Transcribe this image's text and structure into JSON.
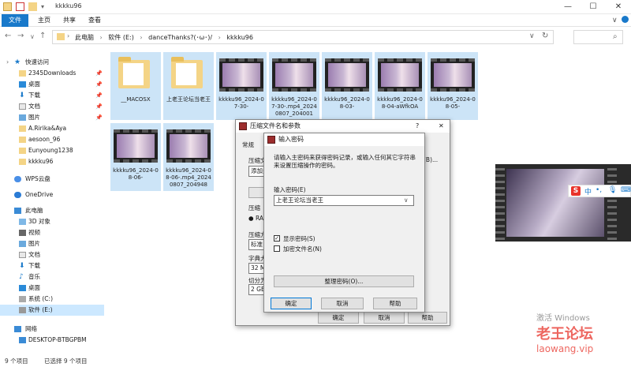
{
  "window": {
    "title": "kkkku96"
  },
  "ribbon": {
    "tabs": [
      "文件",
      "主页",
      "共享",
      "查看"
    ]
  },
  "address": {
    "crumbs": [
      "此电脑",
      "软件 (E:)",
      "danceThanks?(･ω･)/",
      "kkkku96"
    ],
    "refresh_icon": "refresh-icon"
  },
  "sidebar": {
    "quick_access": "快速访问",
    "quick_items": [
      {
        "label": "2345Downloads",
        "pinned": true
      },
      {
        "label": "桌面",
        "pinned": true
      },
      {
        "label": "下载",
        "pinned": true
      },
      {
        "label": "文档",
        "pinned": true
      },
      {
        "label": "图片",
        "pinned": true
      },
      {
        "label": "A.Ririka&Aya",
        "pinned": false
      },
      {
        "label": "aesoon_96",
        "pinned": false
      },
      {
        "label": "Eunyoung1238",
        "pinned": false
      },
      {
        "label": "kkkku96",
        "pinned": false
      }
    ],
    "wps": "WPS云盘",
    "onedrive": "OneDrive",
    "this_pc": "此电脑",
    "pc_items": [
      "3D 对象",
      "视频",
      "图片",
      "文档",
      "下载",
      "音乐",
      "桌面",
      "系统 (C:)",
      "软件 (E:)"
    ],
    "network": "网络",
    "network_items": [
      "DESKTOP-BTBGPBM"
    ]
  },
  "files": [
    {
      "name": "__MACOSX",
      "kind": "folder"
    },
    {
      "name": "上老王论坛当老王",
      "kind": "folder"
    },
    {
      "name": "kkkku96_2024-07-30-",
      "kind": "video"
    },
    {
      "name": "kkkku96_2024-07-30-.mp4_20240807_204001",
      "kind": "video"
    },
    {
      "name": "kkkku96_2024-08-03-",
      "kind": "video"
    },
    {
      "name": "kkkku96_2024-08-04-aWfkOA",
      "kind": "video"
    },
    {
      "name": "kkkku96_2024-08-05-",
      "kind": "video"
    },
    {
      "name": "kkkku96_2024-08-06-",
      "kind": "video"
    },
    {
      "name": "kkkku96_2024-08-06-.mp4_20240807_204948",
      "kind": "video"
    }
  ],
  "status": {
    "count": "9 个项目",
    "selected": "已选择 9 个项目"
  },
  "archive_dialog": {
    "title": "压缩文件名和参数",
    "help": "?",
    "tab_general": "常规",
    "lbl_name": "压缩文",
    "lbl_update": "更新方",
    "update_value": "添加并",
    "lbl_format": "压缩",
    "fmt_rar": "RA",
    "lbl_method": "压缩方",
    "method_value": "标准",
    "lbl_dict": "字典大",
    "dict_value": "32 MB",
    "lbl_split": "切分为",
    "split_value": "2 GB",
    "partial_value": "(B)...",
    "ok": "确定",
    "cancel": "取消",
    "help_btn": "帮助"
  },
  "password_dialog": {
    "title": "输入密码",
    "instruction": "请输入主密码来获得密码记录，或输入任何其它字符串来设置压缩操作的密码。",
    "password_label": "输入密码(E)",
    "password_value": "上老王论坛当老王",
    "show_password": "显示密码(S)",
    "show_password_checked": true,
    "encrypt_names": "加密文件名(N)",
    "encrypt_names_checked": false,
    "organize": "整理密码(O)...",
    "ok": "确定",
    "cancel": "取消",
    "help": "帮助"
  },
  "ime": {
    "logo": "S",
    "mode": "中"
  },
  "watermark": {
    "line1": "激活 Windows",
    "line2": "老王论坛",
    "line3": "laowang.vip"
  },
  "colors": {
    "accent": "#1979ca",
    "selection": "#cce8ff",
    "ime_red": "#e8332a"
  }
}
